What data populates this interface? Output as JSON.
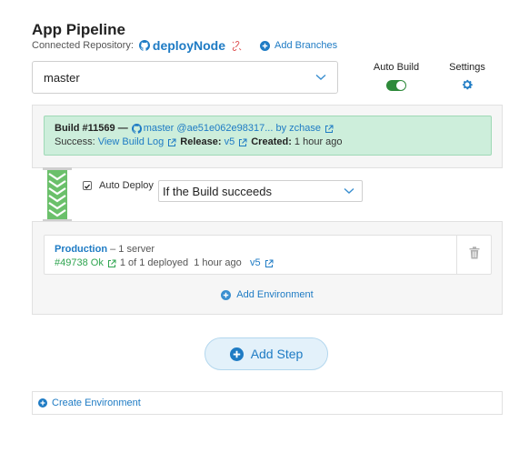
{
  "header": {
    "title": "App Pipeline",
    "repo_label": "Connected Repository:",
    "repo_name": "deployNode",
    "add_branches": "Add Branches"
  },
  "branch": {
    "selected": "master"
  },
  "auto_build": {
    "label": "Auto Build",
    "enabled": true
  },
  "settings": {
    "label": "Settings"
  },
  "build": {
    "title": "Build #11569 —",
    "branch": "master",
    "commit": "@ae51e062e98317...",
    "by": "by zchase",
    "success_label": "Success:",
    "view_log": "View Build Log",
    "release_label": "Release:",
    "release_value": "v5",
    "created_label": "Created:",
    "created_value": "1 hour ago"
  },
  "auto_deploy": {
    "label": "Auto Deploy",
    "checked": true,
    "condition": "If the Build succeeds"
  },
  "production": {
    "name": "Production",
    "servers": "– 1 server",
    "release_id": "#49738 Ok",
    "deployed": "1 of 1 deployed",
    "time": "1 hour ago",
    "version": "v5",
    "add_environment": "Add Environment"
  },
  "actions": {
    "add_step": "Add Step",
    "create_environment": "Create Environment"
  },
  "colors": {
    "accent": "#1e7bc4",
    "success": "#2ea44f",
    "toggle_on": "#2e8a3a",
    "build_bg": "#cdeedb"
  }
}
